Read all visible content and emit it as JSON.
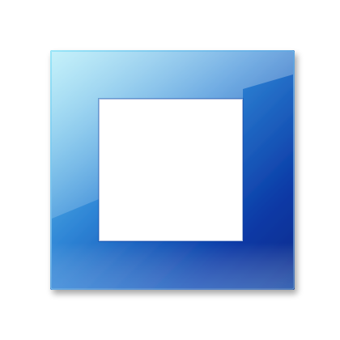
{
  "icon": {
    "name": "square-frame-icon",
    "colors": {
      "light": "#7fe0f4",
      "mid": "#2f86d6",
      "dark": "#0a3aa6",
      "deep": "#062a8a",
      "background": "#ffffff"
    }
  }
}
